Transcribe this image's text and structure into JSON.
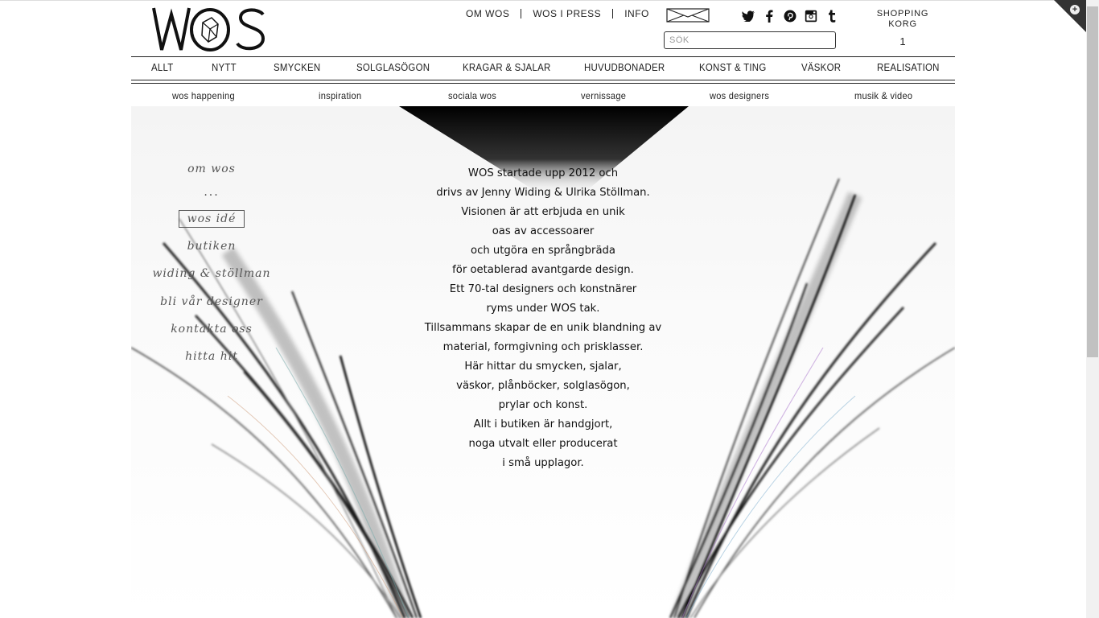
{
  "logo": {
    "text": "WOS"
  },
  "top_links": [
    "OM WOS",
    "WOS I PRESS",
    "INFO"
  ],
  "social_icons": [
    "twitter-icon",
    "facebook-icon",
    "pinterest-icon",
    "instagram-icon",
    "tumblr-icon"
  ],
  "search": {
    "placeholder": "SÖK",
    "value": ""
  },
  "cart": {
    "label_line1": "SHOPPING",
    "label_line2": "KORG",
    "count": "1"
  },
  "main_nav": [
    "ALLT",
    "NYTT",
    "SMYCKEN",
    "SOLGLASÖGON",
    "KRAGAR & SJALAR",
    "HUVUDBONADER",
    "KONST & TING",
    "VÄSKOR",
    "REALISATION"
  ],
  "sub_nav": [
    "wos happening",
    "inspiration",
    "sociala wos",
    "vernissage",
    "wos designers",
    "musik & video"
  ],
  "side_nav": {
    "om_wos": "om wos",
    "dots": "...",
    "active": "wos idé",
    "butiken": "butiken",
    "widing": "widing & stöllman",
    "designer": "bli vår designer",
    "kontakta": "kontakta oss",
    "hitta": "hitta hit"
  },
  "about_text": [
    "WOS startade upp 2012 och",
    "drivs av Jenny Widing & Ulrika Stöllman.",
    "Visionen är att erbjuda en unik",
    "oas av accessoarer",
    "och utgöra en språngbräda",
    "för oetablerad avantgarde design.",
    "Ett 70-tal designers och konstnärer",
    "ryms under WOS tak.",
    "Tillsammans skapar de en unik blandning av",
    "material, formgivning och prisklasser.",
    "Här hittar du smycken, sjalar,",
    "väskor, plånböcker, solglasögon,",
    "prylar och konst.",
    "Allt i butiken är handgjort,",
    "noga utvalt eller producerat",
    "i små upplagor."
  ],
  "colors": {
    "text": "#222222",
    "accent": "#000000",
    "background": "#ffffff"
  }
}
